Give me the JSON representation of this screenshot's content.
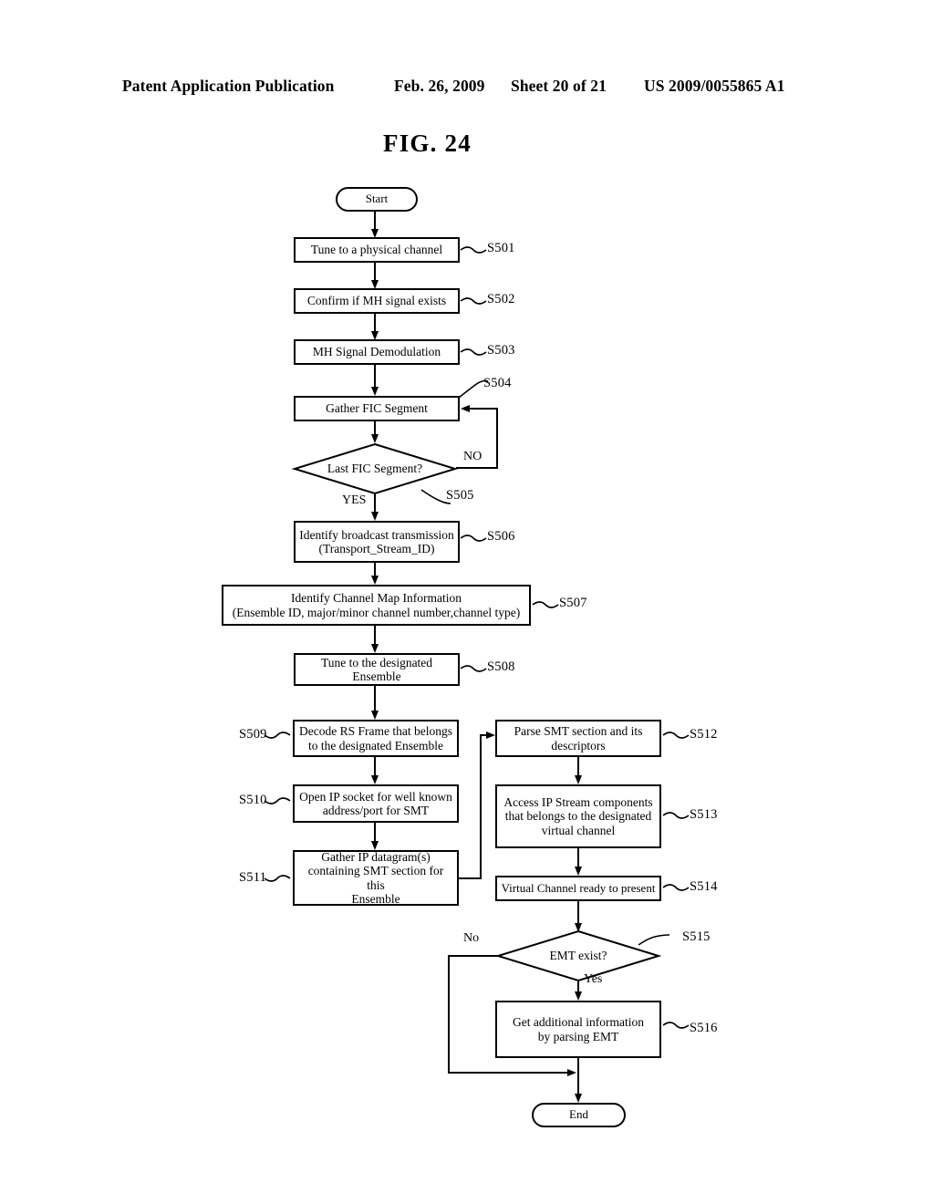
{
  "header": {
    "title": "Patent Application Publication",
    "date": "Feb. 26, 2009",
    "sheet": "Sheet 20 of 21",
    "number": "US 2009/0055865 A1"
  },
  "figure": {
    "label": "FIG. 24"
  },
  "flowchart": {
    "start_label": "Start",
    "end_label": "End",
    "nodes": [
      {
        "id": "start",
        "type": "terminator",
        "text": "Start",
        "ref": ""
      },
      {
        "id": "s501",
        "type": "process",
        "text": "Tune to a physical channel",
        "ref": "S501"
      },
      {
        "id": "s502",
        "type": "process",
        "text": "Confirm if MH signal exists",
        "ref": "S502"
      },
      {
        "id": "s503",
        "type": "process",
        "text": "MH Signal Demodulation",
        "ref": "S503"
      },
      {
        "id": "s504",
        "type": "process",
        "text": "Gather FIC Segment",
        "ref": "S504"
      },
      {
        "id": "s505",
        "type": "decision",
        "text": "Last FIC Segment?",
        "ref": "S505"
      },
      {
        "id": "s506",
        "type": "process",
        "text_line1": "Identify broadcast transmission",
        "text_line2": "(Transport_Stream_ID)",
        "ref": "S506"
      },
      {
        "id": "s507",
        "type": "process",
        "text_line1": "Identify Channel Map Information",
        "text_line2": "(Ensemble ID, major/minor channel number,channel type)",
        "ref": "S507"
      },
      {
        "id": "s508",
        "type": "process",
        "text_line1": "Tune to the designated",
        "text_line2": "Ensemble",
        "ref": "S508"
      },
      {
        "id": "s509",
        "type": "process",
        "text_line1": "Decode RS Frame that belongs",
        "text_line2": "to the designated Ensemble",
        "ref": "S509"
      },
      {
        "id": "s510",
        "type": "process",
        "text_line1": "Open IP socket for well known",
        "text_line2": "address/port for SMT",
        "ref": "S510"
      },
      {
        "id": "s511",
        "type": "process",
        "text_line1": "Gather IP datagram(s)",
        "text_line2": "containing SMT section for this",
        "text_line3": "Ensemble",
        "ref": "S511"
      },
      {
        "id": "s512",
        "type": "process",
        "text_line1": "Parse SMT section and its",
        "text_line2": "descriptors",
        "ref": "S512"
      },
      {
        "id": "s513",
        "type": "process",
        "text_line1": "Access IP Stream components",
        "text_line2": "that belongs to the designated",
        "text_line3": "virtual channel",
        "ref": "S513"
      },
      {
        "id": "s514",
        "type": "process",
        "text": "Virtual Channel ready to present",
        "ref": "S514"
      },
      {
        "id": "s515",
        "type": "decision",
        "text": "EMT exist?",
        "ref": "S515"
      },
      {
        "id": "s516",
        "type": "process",
        "text_line1": "Get additional information",
        "text_line2": "by parsing EMT",
        "ref": "S516"
      },
      {
        "id": "end",
        "type": "terminator",
        "text": "End",
        "ref": ""
      }
    ],
    "branch_labels": {
      "fic_no": "NO",
      "fic_yes": "YES",
      "emt_no": "No",
      "emt_yes": "Yes"
    }
  }
}
